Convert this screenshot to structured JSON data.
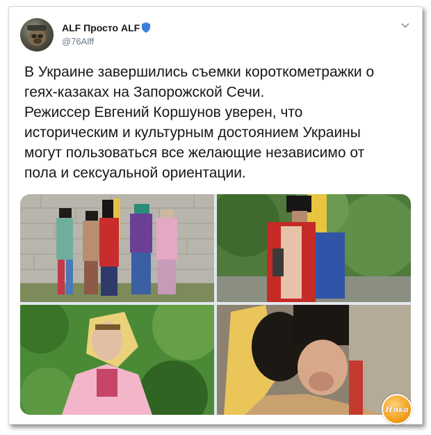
{
  "tweet": {
    "author": {
      "display_name": "ALF Просто ALF",
      "handle": "@76Alff",
      "verified_badge_icon": "shield-icon",
      "verified_color": "#3b7fe0"
    },
    "menu_icon": "chevron-down-icon",
    "text_lines": [
      "В Украине завершились съемки короткометражки о",
      "геях-казаках на Запорожской Сечи.",
      "Режиссер Евгений Коршунов уверен, что",
      "историческим и культурным достоянием Украины",
      "могут пользоваться все желающие независимо от",
      "пола и сексуальной ориентации."
    ],
    "media": [
      {
        "kind": "photo",
        "subject": "five costumed cossacks by stone wall"
      },
      {
        "kind": "photo",
        "subject": "cossack in red coat with yellow-blue flag"
      },
      {
        "kind": "photo",
        "subject": "person in pink with yellow headscarf in greenery"
      },
      {
        "kind": "photo",
        "subject": "close-up of cossack in tall black hat"
      }
    ]
  },
  "watermark": {
    "text": "Няка",
    "color": "#f4a11e"
  },
  "colors": {
    "text": "#14171a",
    "secondary_text": "#657786",
    "background": "#ffffff"
  }
}
